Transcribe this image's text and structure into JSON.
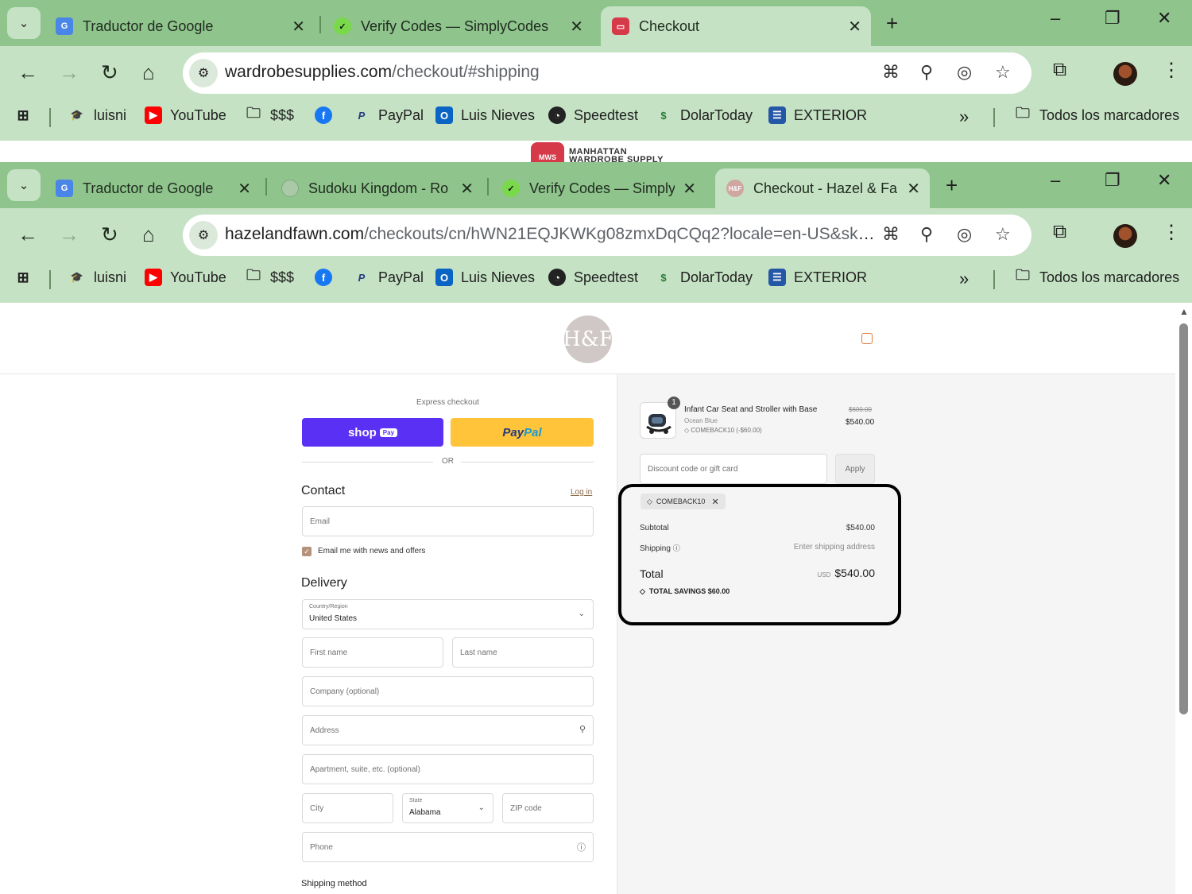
{
  "window1": {
    "tabs": [
      {
        "title": "Traductor de Google",
        "active": false
      },
      {
        "title": "Verify Codes — SimplyCodes",
        "active": false
      },
      {
        "title": "Checkout",
        "active": true
      }
    ],
    "url_host": "wardrobesupplies.com",
    "url_path": "/checkout/#shipping"
  },
  "window2": {
    "tabs": [
      {
        "title": "Traductor de Google",
        "active": false
      },
      {
        "title": "Sudoku Kingdom - Ro",
        "active": false
      },
      {
        "title": "Verify Codes — Simply",
        "active": false
      },
      {
        "title": "Checkout - Hazel & Fa",
        "active": true
      }
    ],
    "url_host": "hazelandfawn.com",
    "url_path": "/checkouts/cn/hWN21EQJKWKg08zmxDqCQq2?locale=en-US&skip..."
  },
  "bookmarks": {
    "items": [
      "luisni",
      "YouTube",
      "$$$",
      "PayPal",
      "Luis Nieves",
      "Speedtest",
      "DolarToday",
      "EXTERIOR"
    ],
    "all": "Todos los marcadores",
    "more": "»"
  },
  "store_strip": {
    "badge": "MWS",
    "name_line1": "MANHATTAN",
    "name_line2": "WARDROBE SUPPLY"
  },
  "checkout": {
    "logo": "H&F",
    "express_label": "Express checkout",
    "shop_pay": "shop",
    "shop_pay_badge": "Pay",
    "paypal_a": "Pay",
    "paypal_b": "Pal",
    "or": "OR",
    "contact_heading": "Contact",
    "login": "Log in",
    "email_placeholder": "Email",
    "newsletter": "Email me with news and offers",
    "delivery_heading": "Delivery",
    "country_label": "Country/Region",
    "country_value": "United States",
    "first_name": "First name",
    "last_name": "Last name",
    "company": "Company (optional)",
    "address": "Address",
    "apartment": "Apartment, suite, etc. (optional)",
    "city": "City",
    "state_label": "State",
    "state_value": "Alabama",
    "zip": "ZIP code",
    "phone": "Phone",
    "shipping_method": "Shipping method"
  },
  "summary": {
    "qty": "1",
    "product_name": "Infant Car Seat and Stroller with Base",
    "variant": "Ocean Blue",
    "product_discount": "COMEBACK10 (-$60.00)",
    "price_old": "$600.00",
    "price_new": "$540.00",
    "discount_placeholder": "Discount code or gift card",
    "apply": "Apply",
    "code_chip": "COMEBACK10",
    "subtotal_label": "Subtotal",
    "subtotal_value": "$540.00",
    "shipping_label": "Shipping",
    "shipping_value": "Enter shipping address",
    "total_label": "Total",
    "currency": "USD",
    "total_value": "$540.00",
    "savings": "TOTAL SAVINGS  $60.00"
  },
  "colors": {
    "chrome": "#c5e2c4",
    "tabstrip": "#8fc48d",
    "shop_pay": "#5a31f4",
    "paypal": "#ffc439"
  }
}
